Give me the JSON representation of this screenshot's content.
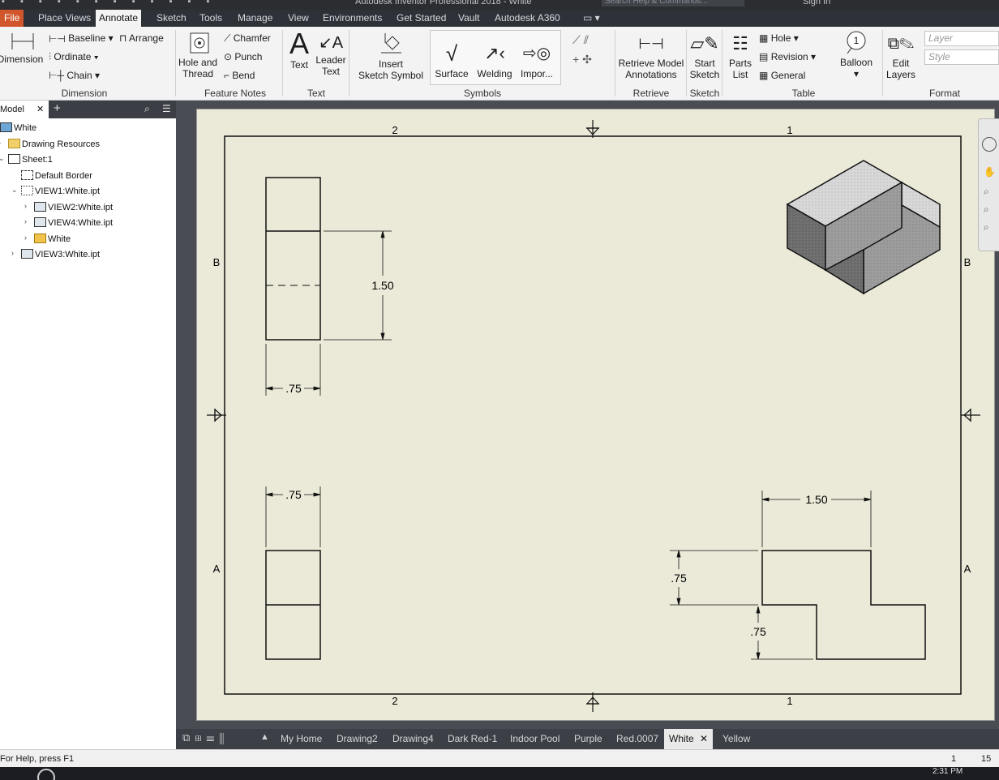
{
  "window": {
    "title": "Autodesk Inventor Professional 2018 - White",
    "search_placeholder": "Search Help & Commands...",
    "sign_in": "Sign In"
  },
  "menu_tabs": [
    "File",
    "Place Views",
    "Annotate",
    "Sketch",
    "Tools",
    "Manage",
    "View",
    "Environments",
    "Get Started",
    "Vault",
    "Autodesk A360"
  ],
  "active_tab": "Annotate",
  "ribbon": {
    "dimension": {
      "big": "Dimension",
      "baseline": "Baseline",
      "arrange": "Arrange",
      "ordinate": "Ordinate",
      "chain": "Chain",
      "group": "Dimension"
    },
    "feature_notes": {
      "hole_thread_1": "Hole and",
      "hole_thread_2": "Thread",
      "chamfer": "Chamfer",
      "punch": "Punch",
      "bend": "Bend",
      "group": "Feature Notes"
    },
    "text": {
      "text": "Text",
      "leader_1": "Leader",
      "leader_2": "Text",
      "group": "Text"
    },
    "symbols": {
      "insert_1": "Insert",
      "insert_2": "Sketch Symbol",
      "surface": "Surface",
      "welding": "Welding",
      "import": "Impor...",
      "group": "Symbols"
    },
    "retrieve": {
      "label_1": "Retrieve Model",
      "label_2": "Annotations",
      "group": "Retrieve"
    },
    "sketch": {
      "label_1": "Start",
      "label_2": "Sketch",
      "group": "Sketch"
    },
    "table": {
      "parts_1": "Parts",
      "parts_2": "List",
      "hole": "Hole",
      "revision": "Revision",
      "general": "General",
      "group": "Table"
    },
    "balloon": {
      "label": "Balloon",
      "num": "1"
    },
    "format": {
      "edit_1": "Edit",
      "edit_2": "Layers",
      "layer_placeholder": "Layer",
      "style_placeholder": "Style",
      "group": "Format"
    }
  },
  "browser": {
    "tab": "Model",
    "tree": [
      {
        "label": "White",
        "level": 0
      },
      {
        "label": "Drawing Resources",
        "level": 1
      },
      {
        "label": "Sheet:1",
        "level": 1
      },
      {
        "label": "Default Border",
        "level": 2
      },
      {
        "label": "VIEW1:White.ipt",
        "level": 2
      },
      {
        "label": "VIEW2:White.ipt",
        "level": 3
      },
      {
        "label": "VIEW4:White.ipt",
        "level": 3
      },
      {
        "label": "White",
        "level": 3
      },
      {
        "label": "VIEW3:White.ipt",
        "level": 2
      }
    ]
  },
  "drawing": {
    "zone_cols": [
      "2",
      "1"
    ],
    "zone_rows": [
      "B",
      "A"
    ],
    "dims": {
      "side_height": "1.50",
      "side_width": ".75",
      "bottom_width": ".75",
      "front_width": "1.50",
      "front_h1": ".75",
      "front_h2": ".75"
    }
  },
  "doc_tabs": [
    "My Home",
    "Drawing2",
    "Drawing4",
    "Dark Red-1",
    "Indoor Pool",
    "Purple",
    "Red.0007",
    "White",
    "Yellow"
  ],
  "active_doc": "White",
  "status": {
    "help": "For Help, press F1",
    "n1": "1",
    "n2": "15"
  },
  "taskbar": {
    "time": "2:31 PM"
  },
  "colors": {
    "file_tab": "#d1562c",
    "sheet": "#ebe9d8",
    "canvas": "#494c52"
  }
}
